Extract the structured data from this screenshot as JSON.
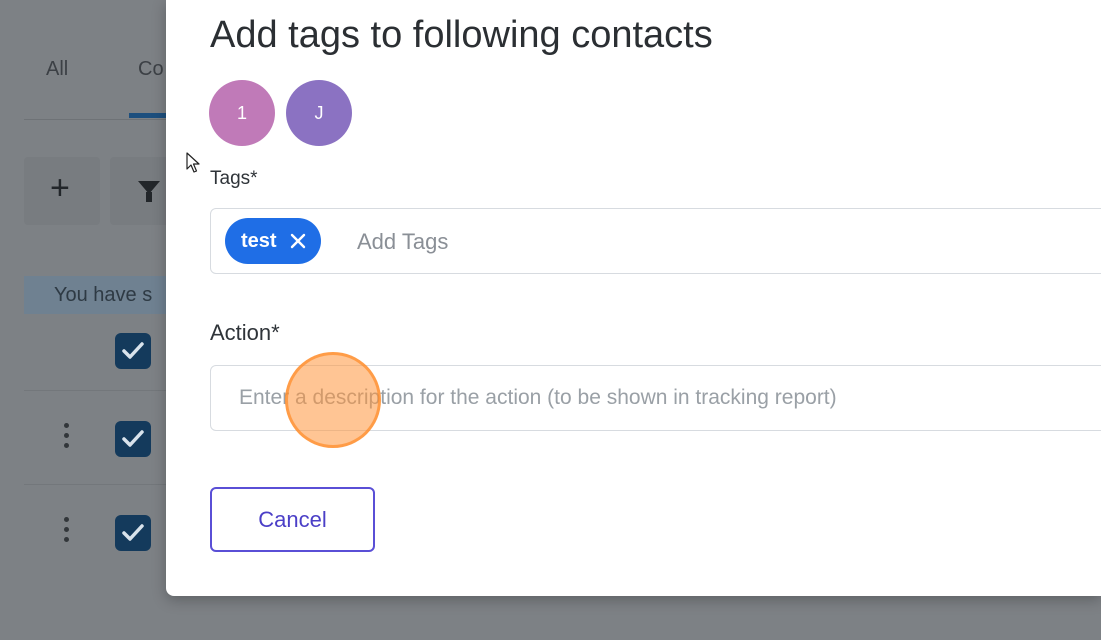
{
  "background": {
    "tabs": [
      {
        "label": "All"
      },
      {
        "label": "Co"
      }
    ],
    "selection_banner": "You have s",
    "add_icon": "plus-icon",
    "filter_icon": "filter-icon"
  },
  "modal": {
    "title": "Add tags to following contacts",
    "avatars": [
      {
        "initial": "1",
        "color": "#c07ab8"
      },
      {
        "initial": "J",
        "color": "#8b72c2"
      }
    ],
    "tags": {
      "label": "Tags*",
      "chips": [
        {
          "label": "test"
        }
      ],
      "placeholder": "Add Tags",
      "chip_color": "#1f6ee6"
    },
    "action": {
      "label": "Action*",
      "placeholder": "Enter a description for the action (to be shown in tracking report)"
    },
    "cancel_label": "Cancel",
    "accent_color": "#5a4fd6"
  }
}
